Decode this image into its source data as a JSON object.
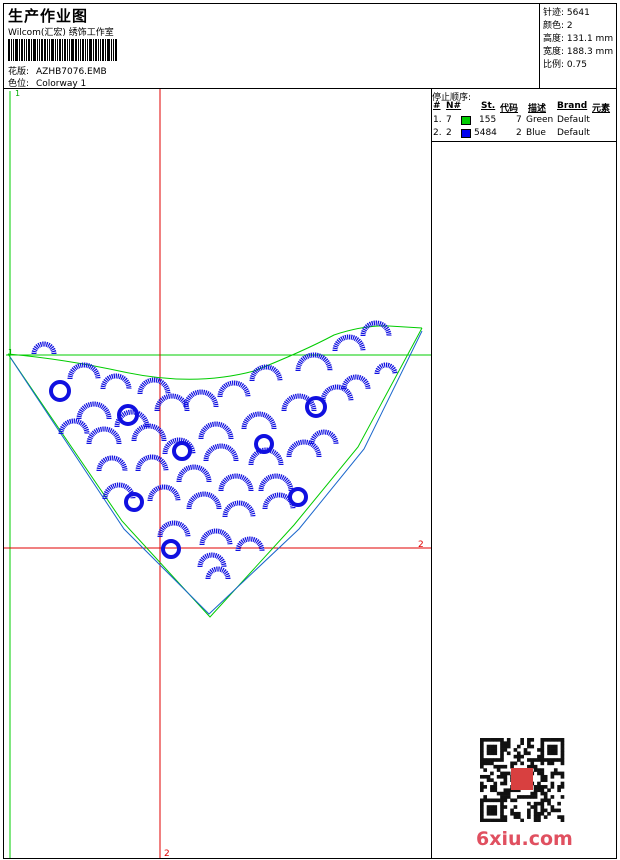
{
  "header": {
    "title": "生产作业图",
    "subtitle": "Wilcom(汇宏) 绣饰工作室",
    "pattern_label": "花版:",
    "pattern_value": "AZHB7076.EMB",
    "colorway_label": "色位:",
    "colorway_value": "Colorway 1"
  },
  "stats": {
    "stitches_label": "针迹:",
    "stitches_value": "5641",
    "colors_label": "颜色:",
    "colors_value": "2",
    "height_label": "高度:",
    "height_value": "131.1 mm",
    "width_label": "宽度:",
    "width_value": "188.3 mm",
    "scale_label": "比例:",
    "scale_value": "0.75"
  },
  "stop_sequence": {
    "title": "停止顺序:",
    "columns": [
      "#",
      "N#",
      "St.",
      "代码",
      "描述",
      "Brand",
      "元素"
    ],
    "rows": [
      {
        "idx": "1.",
        "n": "7",
        "stitches": "155",
        "code": "7",
        "desc": "Green",
        "brand": "Default",
        "color": "#00cc00"
      },
      {
        "idx": "2.",
        "n": "2",
        "stitches": "5484",
        "code": "2",
        "desc": "Blue",
        "brand": "Default",
        "color": "#0000ee"
      }
    ]
  },
  "markers": {
    "corner_top": "1",
    "corner_left": "1",
    "cross_right": "2",
    "cross_bottom": "2"
  },
  "colors": {
    "guide_red": "#e00000",
    "outline_green": "#00cc00",
    "outline_blue": "#1a66cc",
    "stitch_blue": "#1010e0"
  },
  "watermark": "6xiu.com",
  "qr_icon": "qr-code-icon"
}
